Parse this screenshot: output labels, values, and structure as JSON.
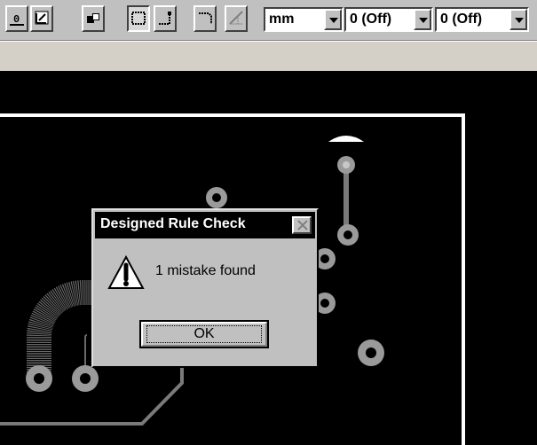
{
  "toolbar": {
    "buttons": [
      {
        "name": "layer-number-button",
        "glyph": "0"
      },
      {
        "name": "grid-corner-button"
      },
      {
        "name": "component-button"
      },
      {
        "name": "select-rect-button"
      },
      {
        "name": "corner-route-button"
      },
      {
        "name": "corner-bevel-button"
      },
      {
        "name": "diagonal-route-button"
      }
    ],
    "unit_select": {
      "value": "mm"
    },
    "option_select_1": {
      "value": "0 (Off)"
    },
    "option_select_2": {
      "value": "0 (Off)"
    }
  },
  "dialog": {
    "title": "Designed Rule Check",
    "message": "1 mistake found",
    "ok_label": "OK",
    "icon": "warning-icon"
  },
  "colors": {
    "canvas_bg": "#000000",
    "trace": "#7a7a7a",
    "board_outline": "#ffffff",
    "pad": "#9a9a9a"
  }
}
